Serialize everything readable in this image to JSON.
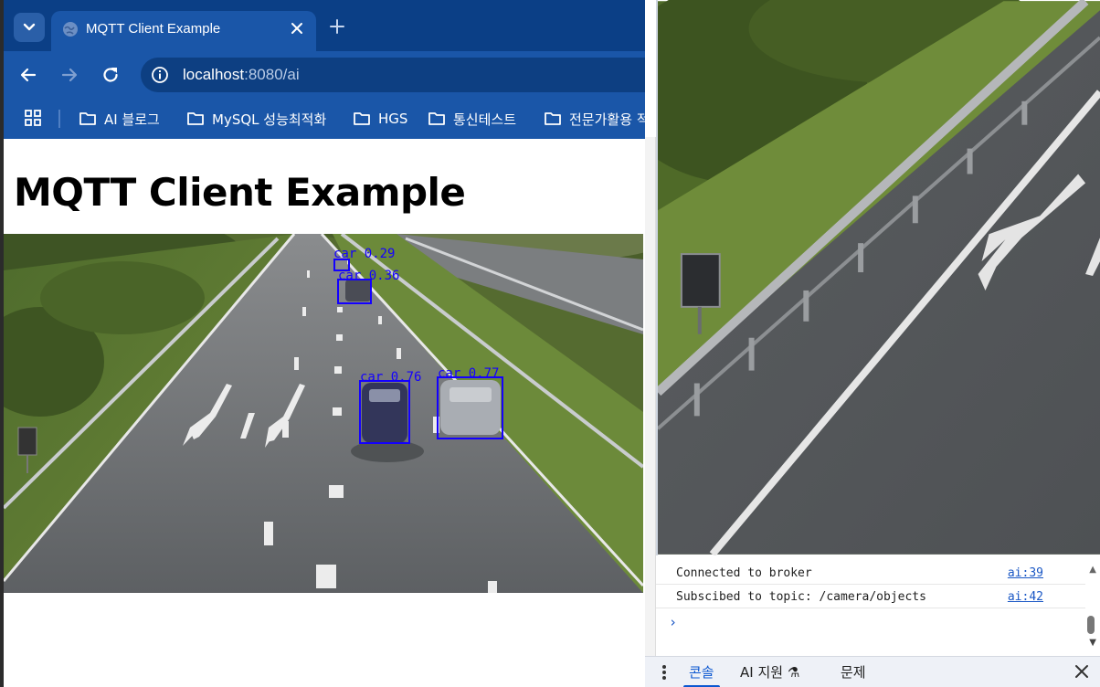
{
  "browser": {
    "tab_title": "MQTT Client Example",
    "url_host": "localhost",
    "url_path": ":8080/ai",
    "bookmarks": [
      {
        "label": "AI 블로그"
      },
      {
        "label": "MySQL 성능최적화"
      },
      {
        "label": "HGS"
      },
      {
        "label": "통신테스트"
      },
      {
        "label": "전문가활용 적"
      }
    ]
  },
  "page": {
    "heading": "MQTT Client Example",
    "detections": [
      {
        "label": "car 0.29"
      },
      {
        "label": "car 0.36"
      },
      {
        "label": "car 0.76"
      },
      {
        "label": "car 0.77"
      }
    ],
    "box_color": "#1400ff"
  },
  "console": {
    "logs": [
      {
        "message": "Connected to broker",
        "source": "ai:39"
      },
      {
        "message": "Subscibed to topic: /camera/objects",
        "source": "ai:42"
      }
    ],
    "prompt": "›",
    "tabs": [
      {
        "label": "콘솔",
        "active": true
      },
      {
        "label": "AI 지원 ⚗",
        "active": false
      },
      {
        "label": "문제",
        "active": false
      }
    ]
  },
  "colors": {
    "tabstrip": "#0b3f86",
    "toolbar": "#1a56a8",
    "accent": "#0b57d0"
  },
  "icons": {
    "tab_menu": "chevron-down-icon",
    "favicon": "globe-icon",
    "close": "close-icon",
    "new_tab": "plus-icon",
    "back": "back-arrow-icon",
    "forward": "forward-arrow-icon",
    "reload": "reload-icon",
    "site_info": "info-icon",
    "apps": "apps-grid-icon",
    "bookmark": "folder-icon"
  }
}
